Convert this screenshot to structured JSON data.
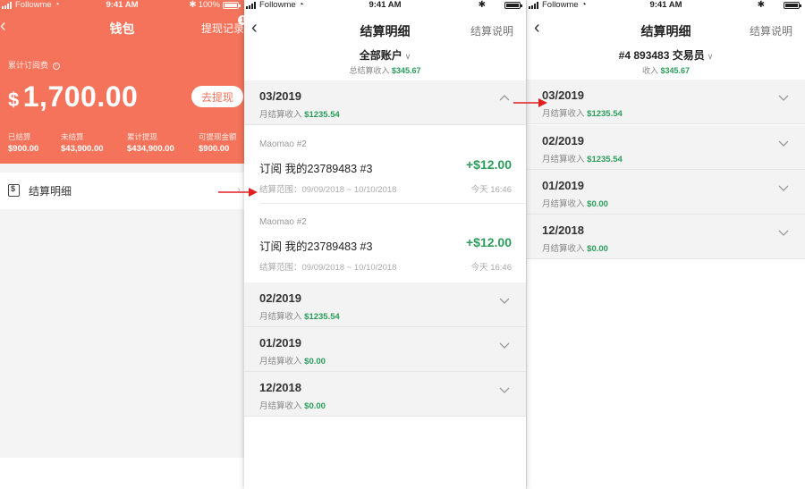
{
  "status_bar": {
    "carrier": "Followme",
    "time": "9:41 AM",
    "battery_pct": "100%"
  },
  "wallet": {
    "title": "钱包",
    "withdraw_records": "提现记录",
    "badge": "1",
    "total_label": "累计订阅费",
    "currency": "$",
    "amount": "1,700.00",
    "withdraw_button": "去提现",
    "stats": [
      {
        "label": "已结算",
        "value": "$900.00"
      },
      {
        "label": "未结算",
        "value": "$43,900.00"
      },
      {
        "label": "累计提现",
        "value": "$434,900.00"
      },
      {
        "label": "可提现金额",
        "value": "$900.00"
      }
    ],
    "row_label": "结算明细"
  },
  "detail_all": {
    "title": "结算明细",
    "help_link": "结算说明",
    "account": "全部账户",
    "total_label": "总结算收入",
    "total_value": "$345.67",
    "months": [
      {
        "month": "03/2019",
        "income_label": "月结算收入",
        "income": "$1235.54",
        "expanded": true
      },
      {
        "month": "02/2019",
        "income_label": "月结算收入",
        "income": "$1235.54",
        "expanded": false
      },
      {
        "month": "01/2019",
        "income_label": "月结算收入",
        "income": "$0.00",
        "expanded": false
      },
      {
        "month": "12/2018",
        "income_label": "月结算收入",
        "income": "$0.00",
        "expanded": false
      }
    ],
    "items": [
      {
        "source": "Maomao #2",
        "desc": "订阅 我的23789483 #3",
        "amount": "+$12.00",
        "range": "结算范围：09/09/2018 ~ 10/10/2018",
        "when": "今天 16:46"
      },
      {
        "source": "Maomao #2",
        "desc": "订阅 我的23789483 #3",
        "amount": "+$12.00",
        "range": "结算范围：09/09/2018 ~ 10/10/2018",
        "when": "今天 16:46"
      }
    ]
  },
  "detail_account": {
    "title": "结算明细",
    "help_link": "结算说明",
    "account": "#4 893483 交易员",
    "total_label": "收入",
    "total_value": "$345.67",
    "months": [
      {
        "month": "03/2019",
        "income_label": "月结算收入",
        "income": "$1235.54"
      },
      {
        "month": "02/2019",
        "income_label": "月结算收入",
        "income": "$1235.54"
      },
      {
        "month": "01/2019",
        "income_label": "月结算收入",
        "income": "$0.00"
      },
      {
        "month": "12/2018",
        "income_label": "月结算收入",
        "income": "$0.00"
      }
    ]
  },
  "colors": {
    "wallet_header": "#f4735a",
    "income_green": "#2a9d5b",
    "annotation_arrow": "#e02020"
  }
}
